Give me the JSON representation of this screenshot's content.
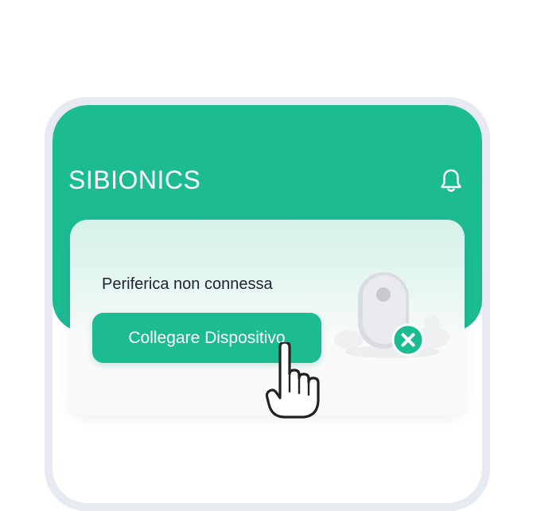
{
  "header": {
    "brand": "SIBIONICS",
    "notification_icon": "bell-icon"
  },
  "device_card": {
    "status_text": "Periferica non connessa",
    "connect_button_label": "Collegare Dispositivo",
    "illustration_icon": "sensor-disconnected-icon",
    "status_badge_icon": "close-icon"
  },
  "colors": {
    "brand_green": "#1dbb92",
    "card_top": "#d5f1ea",
    "card_bottom": "#fafafa",
    "frame": "#e7ebf1",
    "text_dark": "#1e2230"
  }
}
